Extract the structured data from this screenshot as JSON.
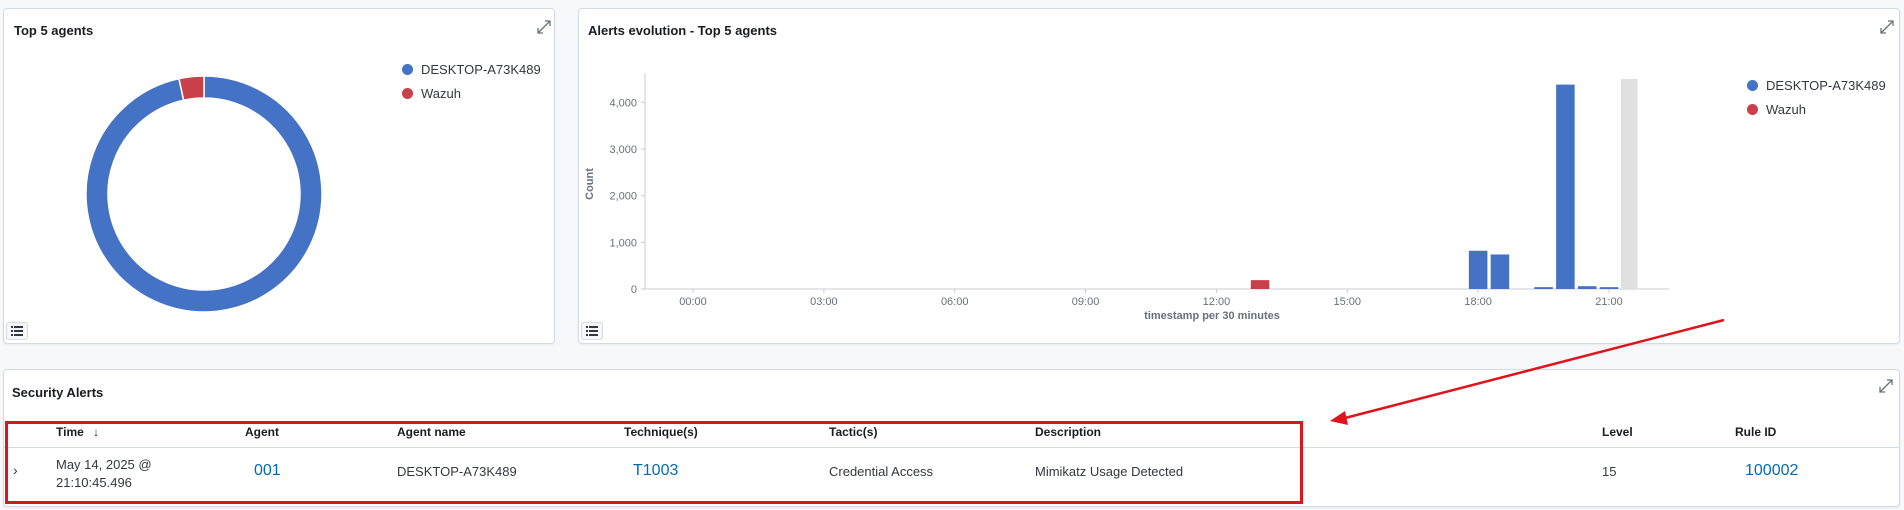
{
  "top_agents_panel": {
    "title": "Top 5 agents",
    "legend": [
      {
        "name": "DESKTOP-A73K489",
        "color": "#4472c4"
      },
      {
        "name": "Wazuh",
        "color": "#c9404b"
      }
    ]
  },
  "evolution_panel": {
    "title": "Alerts evolution - Top 5 agents",
    "legend": [
      {
        "name": "DESKTOP-A73K489",
        "color": "#4472c4"
      },
      {
        "name": "Wazuh",
        "color": "#c9404b"
      }
    ]
  },
  "chart_data": [
    {
      "type": "pie",
      "title": "Top 5 agents",
      "donut": true,
      "labels": [
        "DESKTOP-A73K489",
        "Wazuh"
      ],
      "values": [
        96.6,
        3.4
      ],
      "colors": [
        "#4472c4",
        "#c9404b"
      ]
    },
    {
      "type": "bar",
      "title": "Alerts evolution - Top 5 agents",
      "xlabel": "timestamp per 30 minutes",
      "ylabel": "Count",
      "ylim": [
        0,
        4500
      ],
      "y_ticks": [
        "0",
        "1,000",
        "2,000",
        "3,000",
        "4,000"
      ],
      "y_tick_values": [
        0,
        1000,
        2000,
        3000,
        4000
      ],
      "x_ticks": [
        "00:00",
        "03:00",
        "06:00",
        "09:00",
        "12:00",
        "15:00",
        "18:00",
        "21:00"
      ],
      "x_tick_hours": [
        0,
        3,
        6,
        9,
        12,
        15,
        18,
        21
      ],
      "grid": false,
      "legend_position": "right",
      "series": [
        {
          "name": "DESKTOP-A73K489",
          "color": "#4472c4",
          "points": [
            {
              "hour": 18.0,
              "value": 820
            },
            {
              "hour": 18.5,
              "value": 740
            },
            {
              "hour": 19.5,
              "value": 40
            },
            {
              "hour": 20.0,
              "value": 4380
            },
            {
              "hour": 20.5,
              "value": 60
            },
            {
              "hour": 21.0,
              "value": 40
            }
          ]
        },
        {
          "name": "Wazuh",
          "color": "#c9404b",
          "points": [
            {
              "hour": 13.0,
              "value": 190
            }
          ]
        }
      ],
      "highlighted_hour": 21.0
    }
  ],
  "alerts_panel": {
    "title": "Security Alerts",
    "columns": {
      "time": "Time",
      "agent": "Agent",
      "agent_name": "Agent name",
      "technique": "Technique(s)",
      "tactic": "Tactic(s)",
      "description": "Description",
      "level": "Level",
      "rule_id": "Rule ID"
    },
    "rows": [
      {
        "time_line1": "May 14, 2025 @",
        "time_line2": "21:10:45.496",
        "agent": "001",
        "agent_name": "DESKTOP-A73K489",
        "technique": "T1003",
        "tactic": "Credential Access",
        "description": "Mimikatz Usage Detected",
        "level": "15",
        "rule_id": "100002"
      }
    ]
  }
}
